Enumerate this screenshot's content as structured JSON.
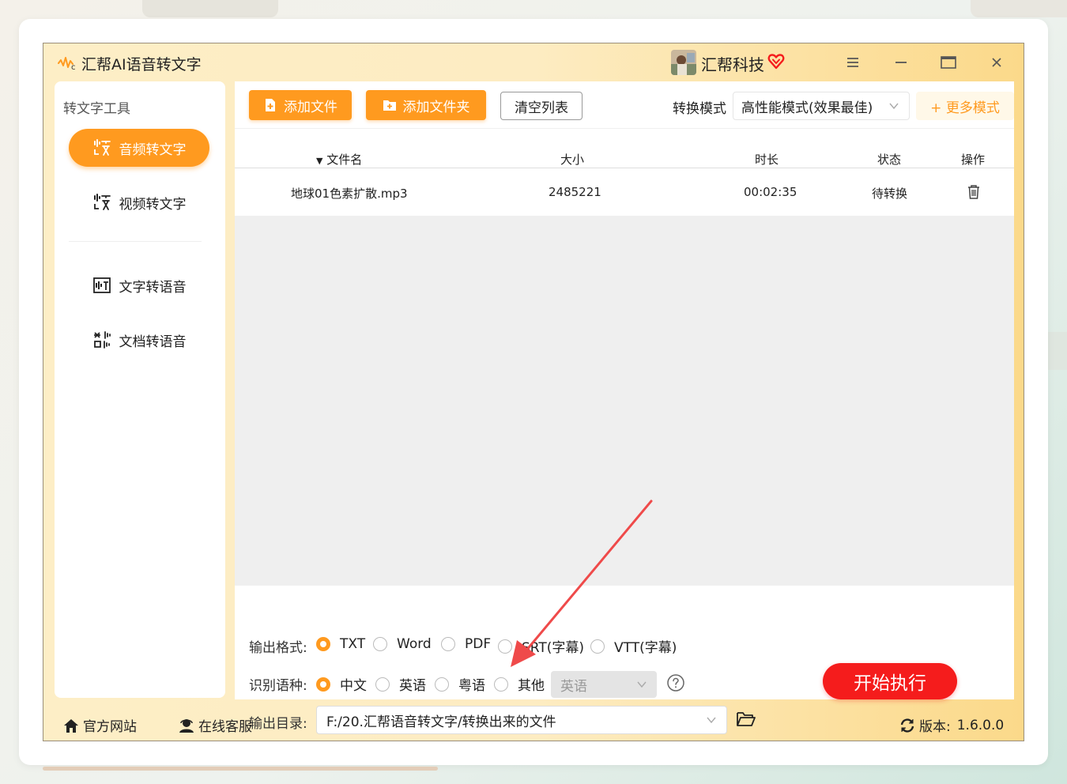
{
  "app": {
    "title": "汇帮AI语音转文字",
    "brand_name": "汇帮科技"
  },
  "window_controls": [
    "menu-icon",
    "minimize-icon",
    "maximize-icon",
    "close-icon"
  ],
  "sidebar": {
    "title": "转文字工具",
    "items": [
      {
        "label": "音频转文字",
        "icon": "audio-to-text-icon",
        "active": true
      },
      {
        "label": "视频转文字",
        "icon": "video-to-text-icon",
        "active": false
      },
      {
        "label": "文字转语音",
        "icon": "text-to-speech-icon",
        "active": false
      },
      {
        "label": "文档转语音",
        "icon": "document-to-speech-icon",
        "active": false
      }
    ]
  },
  "toolbar": {
    "add_file_label": "添加文件",
    "add_folder_label": "添加文件夹",
    "clear_label": "清空列表",
    "mode_label": "转换模式",
    "mode_value": "高性能模式(效果最佳)",
    "more_modes_label": "+ 更多模式"
  },
  "table": {
    "columns": [
      "文件名",
      "大小",
      "时长",
      "状态",
      "操作"
    ],
    "rows": [
      {
        "name": "地球01色素扩散.mp3",
        "size": "2485221",
        "duration": "00:02:35",
        "status": "待转换"
      }
    ]
  },
  "options": {
    "format_label": "输出格式:",
    "formats": [
      "TXT",
      "Word",
      "PDF",
      "SRT(字幕)",
      "VTT(字幕)"
    ],
    "format_selected": "TXT",
    "language_label": "识别语种:",
    "languages": [
      "中文",
      "英语",
      "粤语",
      "其他"
    ],
    "language_selected": "中文",
    "other_language_value": "英语",
    "dir_label": "输出目录:",
    "dir_value": "F:/20.汇帮语音转文字/转换出来的文件"
  },
  "start_button_label": "开始执行",
  "footer": {
    "site_label": "官方网站",
    "service_label": "在线客服",
    "version_label": "版本:",
    "version_value": "1.6.0.0"
  },
  "colors": {
    "accent_orange": "#ff9a1f",
    "start_red": "#f51c1c",
    "window_gradient_start": "#fdeec6",
    "window_gradient_end": "#fbd98a",
    "annotation_arrow": "#ef4a4a"
  }
}
